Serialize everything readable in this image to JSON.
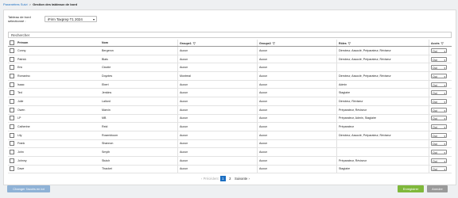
{
  "breadcrumb": {
    "parent": "Paramètres Suivi",
    "separator": ">",
    "current": "Gestion des tableaux de bord"
  },
  "selector": {
    "label": "Tableau de bord sélectionné :",
    "value": "iFirm Taxprep T1 2024"
  },
  "search": {
    "placeholder": "Rechercher"
  },
  "table": {
    "headers": {
      "prenom": "Prénom",
      "nom": "Nom",
      "groupe1": "Groupe1",
      "groupe2": "Groupe2",
      "roles": "Rôles",
      "acces": "Accès"
    },
    "rows": [
      {
        "prenom": "Conny",
        "nom": "Bergeron",
        "groupe1": "Aucun",
        "groupe2": "Aucun",
        "roles": "Directeur, Associé, Préparateur, Réviseur",
        "acces": "Oui"
      },
      {
        "prenom": "Patrick",
        "nom": "Blais",
        "groupe1": "Aucun",
        "groupe2": "Aucun",
        "roles": "Directeur, Associé, Préparateur, Réviseur",
        "acces": "Oui"
      },
      {
        "prenom": "Eric",
        "nom": "Cloutie",
        "groupe1": "Aucun",
        "groupe2": "Aucun",
        "roles": "",
        "acces": "Oui"
      },
      {
        "prenom": "Romarino",
        "nom": "Doyotes",
        "groupe1": "Montreal",
        "groupe2": "Aucun",
        "roles": "Directeur, Associé, Préparateur, Réviseur",
        "acces": "Oui"
      },
      {
        "prenom": "Isaac",
        "nom": "Ebert",
        "groupe1": "Aucun",
        "groupe2": "Aucun",
        "roles": "Admin",
        "acces": "Oui"
      },
      {
        "prenom": "Ted",
        "nom": "Jenkins",
        "groupe1": "Aucun",
        "groupe2": "Aucun",
        "roles": "Stagiaire",
        "acces": "Oui"
      },
      {
        "prenom": "Julie",
        "nom": "Lallord",
        "groupe1": "Aucun",
        "groupe2": "Aucun",
        "roles": "Directeur, Réviseur",
        "acces": "Oui"
      },
      {
        "prenom": "Owen",
        "nom": "Marvin",
        "groupe1": "Aucun",
        "groupe2": "Aucun",
        "roles": "Préparateur, Réviseur",
        "acces": "Oui"
      },
      {
        "prenom": "LP",
        "nom": "MB",
        "groupe1": "Aucun",
        "groupe2": "Aucun",
        "roles": "Préparateur, Admin, Stagiaire",
        "acces": "Oui"
      },
      {
        "prenom": "Catherine",
        "nom": "Reid",
        "groupe1": "Aucun",
        "groupe2": "Aucun",
        "roles": "Préparateur",
        "acces": "Oui"
      },
      {
        "prenom": "Lily",
        "nom": "Rosenbloom",
        "groupe1": "Aucun",
        "groupe2": "Aucun",
        "roles": "Directeur, Associé, Préparateur, Réviseur",
        "acces": "Oui"
      },
      {
        "prenom": "Frank",
        "nom": "Shannon",
        "groupe1": "Aucun",
        "groupe2": "Aucun",
        "roles": "",
        "acces": "Oui"
      },
      {
        "prenom": "John",
        "nom": "Smyth",
        "groupe1": "Aucun",
        "groupe2": "Aucun",
        "roles": "",
        "acces": "Oui"
      },
      {
        "prenom": "Johnny",
        "nom": "Stutch",
        "groupe1": "Aucun",
        "groupe2": "Aucun",
        "roles": "Préparateur, Réviseur",
        "acces": "Oui"
      },
      {
        "prenom": "Dave",
        "nom": "Thacket",
        "groupe1": "Aucun",
        "groupe2": "Aucun",
        "roles": "Stagiaire",
        "acces": "Oui"
      }
    ]
  },
  "pagination": {
    "prev": "Précédent",
    "pages": [
      "1",
      "2"
    ],
    "current": "1",
    "next": "Suivante"
  },
  "buttons": {
    "change_access": "Changer l'accès en lot",
    "save": "Enregistrer",
    "cancel": "Annuler"
  },
  "icons": {
    "filter": "filter-icon",
    "caret": "chevron-down-icon"
  },
  "colors": {
    "link": "#1d6fc2",
    "save": "#7fb83b",
    "change": "#8fb2d6",
    "cancel": "#9a9a9a"
  }
}
